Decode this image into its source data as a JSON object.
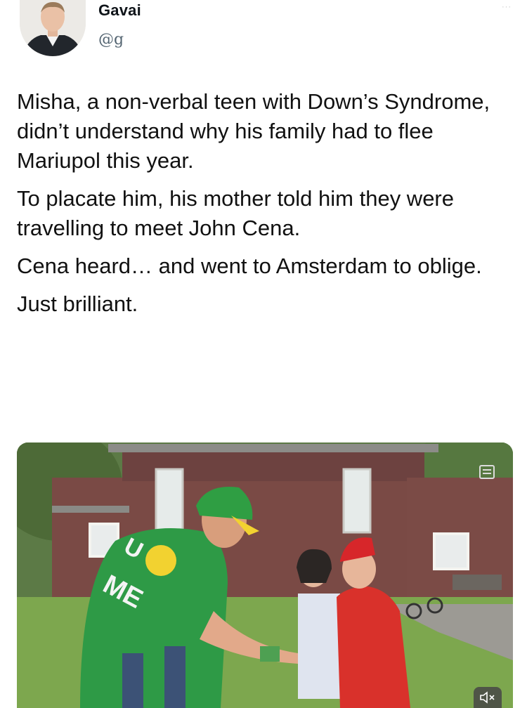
{
  "tweet": {
    "author_name": "Gavai",
    "handle": "@g",
    "menu_glyph": "···",
    "paragraphs": [
      "Misha, a non-verbal teen with Down’s Syndrome, didn’t understand why his family had to flee Mariupol this year.",
      "To placate him, his mother told him they were travelling to meet John Cena.",
      "Cena heard… and went to Amsterdam to oblige.",
      "Just brilliant."
    ],
    "shirt_text_top": "U",
    "shirt_text_bottom": "ME"
  },
  "icons": {
    "avatar": "profile-photo",
    "more": "more-dots-icon",
    "media_badge": "image-badge-icon",
    "mute": "speaker-muted-icon"
  },
  "colors": {
    "text": "#111111",
    "handle": "#536471",
    "shirt_green": "#2e9a46",
    "cap_red": "#d7262a"
  }
}
